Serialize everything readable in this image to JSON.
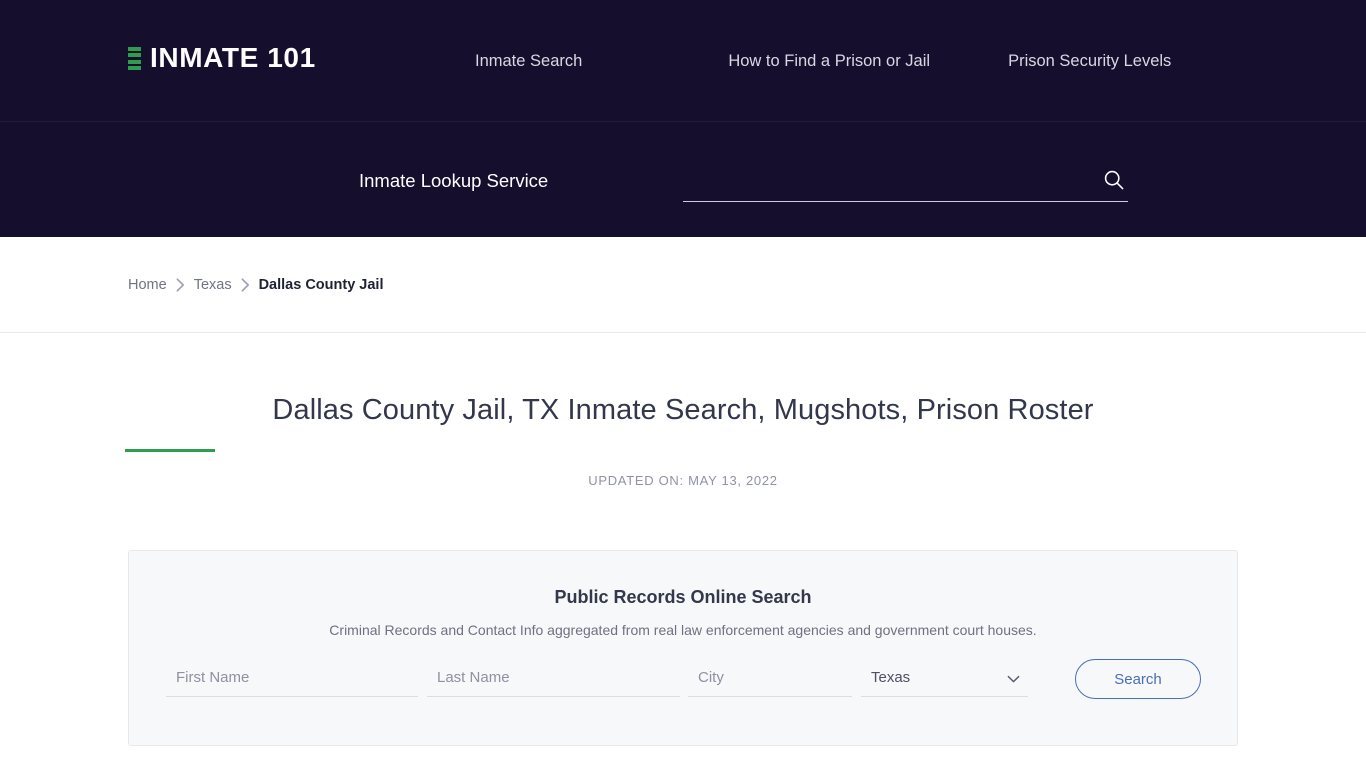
{
  "header": {
    "brand": {
      "name": "INMATE 101",
      "mark_color": "#2e9e4c"
    },
    "nav": [
      {
        "label": "Inmate Search"
      },
      {
        "label": "How to Find a Prison or Jail"
      },
      {
        "label": "Prison Security Levels"
      }
    ],
    "lookup_label": "Inmate Lookup Service",
    "search": {
      "value": "",
      "placeholder": ""
    },
    "background_color": "#150e2d"
  },
  "breadcrumb": {
    "items": [
      {
        "label": "Home",
        "current": false
      },
      {
        "label": "Texas",
        "current": false
      },
      {
        "label": "Dallas County Jail",
        "current": true
      }
    ],
    "separator": "›"
  },
  "main": {
    "title": "Dallas County Jail, TX Inmate Search, Mugshots, Prison Roster",
    "rule_color": "#2e9e4c",
    "updated_on": "UPDATED ON: MAY 13, 2022"
  },
  "records_panel": {
    "title": "Public Records Online Search",
    "subtitle": "Criminal Records and Contact Info aggregated from real law enforcement agencies and government court houses.",
    "form": {
      "first_name": {
        "value": "",
        "placeholder": "First Name"
      },
      "last_name": {
        "value": "",
        "placeholder": "Last Name"
      },
      "city": {
        "value": "",
        "placeholder": "City"
      },
      "state": {
        "selected": "Texas",
        "options": [
          "Texas"
        ]
      },
      "submit_label": "Search",
      "submit_color": "#4a6fb5"
    }
  }
}
